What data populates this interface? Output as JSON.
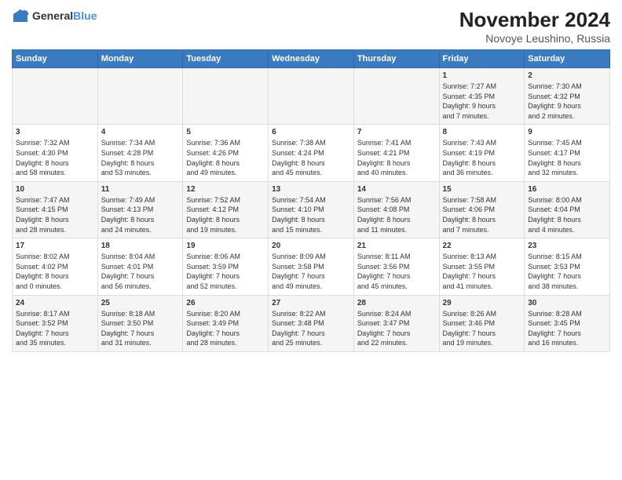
{
  "logo": {
    "general": "General",
    "blue": "Blue"
  },
  "title": "November 2024",
  "subtitle": "Novoye Leushino, Russia",
  "days_of_week": [
    "Sunday",
    "Monday",
    "Tuesday",
    "Wednesday",
    "Thursday",
    "Friday",
    "Saturday"
  ],
  "weeks": [
    [
      {
        "day": "",
        "info": ""
      },
      {
        "day": "",
        "info": ""
      },
      {
        "day": "",
        "info": ""
      },
      {
        "day": "",
        "info": ""
      },
      {
        "day": "",
        "info": ""
      },
      {
        "day": "1",
        "info": "Sunrise: 7:27 AM\nSunset: 4:35 PM\nDaylight: 9 hours\nand 7 minutes."
      },
      {
        "day": "2",
        "info": "Sunrise: 7:30 AM\nSunset: 4:32 PM\nDaylight: 9 hours\nand 2 minutes."
      }
    ],
    [
      {
        "day": "3",
        "info": "Sunrise: 7:32 AM\nSunset: 4:30 PM\nDaylight: 8 hours\nand 58 minutes."
      },
      {
        "day": "4",
        "info": "Sunrise: 7:34 AM\nSunset: 4:28 PM\nDaylight: 8 hours\nand 53 minutes."
      },
      {
        "day": "5",
        "info": "Sunrise: 7:36 AM\nSunset: 4:26 PM\nDaylight: 8 hours\nand 49 minutes."
      },
      {
        "day": "6",
        "info": "Sunrise: 7:38 AM\nSunset: 4:24 PM\nDaylight: 8 hours\nand 45 minutes."
      },
      {
        "day": "7",
        "info": "Sunrise: 7:41 AM\nSunset: 4:21 PM\nDaylight: 8 hours\nand 40 minutes."
      },
      {
        "day": "8",
        "info": "Sunrise: 7:43 AM\nSunset: 4:19 PM\nDaylight: 8 hours\nand 36 minutes."
      },
      {
        "day": "9",
        "info": "Sunrise: 7:45 AM\nSunset: 4:17 PM\nDaylight: 8 hours\nand 32 minutes."
      }
    ],
    [
      {
        "day": "10",
        "info": "Sunrise: 7:47 AM\nSunset: 4:15 PM\nDaylight: 8 hours\nand 28 minutes."
      },
      {
        "day": "11",
        "info": "Sunrise: 7:49 AM\nSunset: 4:13 PM\nDaylight: 8 hours\nand 24 minutes."
      },
      {
        "day": "12",
        "info": "Sunrise: 7:52 AM\nSunset: 4:12 PM\nDaylight: 8 hours\nand 19 minutes."
      },
      {
        "day": "13",
        "info": "Sunrise: 7:54 AM\nSunset: 4:10 PM\nDaylight: 8 hours\nand 15 minutes."
      },
      {
        "day": "14",
        "info": "Sunrise: 7:56 AM\nSunset: 4:08 PM\nDaylight: 8 hours\nand 11 minutes."
      },
      {
        "day": "15",
        "info": "Sunrise: 7:58 AM\nSunset: 4:06 PM\nDaylight: 8 hours\nand 7 minutes."
      },
      {
        "day": "16",
        "info": "Sunrise: 8:00 AM\nSunset: 4:04 PM\nDaylight: 8 hours\nand 4 minutes."
      }
    ],
    [
      {
        "day": "17",
        "info": "Sunrise: 8:02 AM\nSunset: 4:02 PM\nDaylight: 8 hours\nand 0 minutes."
      },
      {
        "day": "18",
        "info": "Sunrise: 8:04 AM\nSunset: 4:01 PM\nDaylight: 7 hours\nand 56 minutes."
      },
      {
        "day": "19",
        "info": "Sunrise: 8:06 AM\nSunset: 3:59 PM\nDaylight: 7 hours\nand 52 minutes."
      },
      {
        "day": "20",
        "info": "Sunrise: 8:09 AM\nSunset: 3:58 PM\nDaylight: 7 hours\nand 49 minutes."
      },
      {
        "day": "21",
        "info": "Sunrise: 8:11 AM\nSunset: 3:56 PM\nDaylight: 7 hours\nand 45 minutes."
      },
      {
        "day": "22",
        "info": "Sunrise: 8:13 AM\nSunset: 3:55 PM\nDaylight: 7 hours\nand 41 minutes."
      },
      {
        "day": "23",
        "info": "Sunrise: 8:15 AM\nSunset: 3:53 PM\nDaylight: 7 hours\nand 38 minutes."
      }
    ],
    [
      {
        "day": "24",
        "info": "Sunrise: 8:17 AM\nSunset: 3:52 PM\nDaylight: 7 hours\nand 35 minutes."
      },
      {
        "day": "25",
        "info": "Sunrise: 8:18 AM\nSunset: 3:50 PM\nDaylight: 7 hours\nand 31 minutes."
      },
      {
        "day": "26",
        "info": "Sunrise: 8:20 AM\nSunset: 3:49 PM\nDaylight: 7 hours\nand 28 minutes."
      },
      {
        "day": "27",
        "info": "Sunrise: 8:22 AM\nSunset: 3:48 PM\nDaylight: 7 hours\nand 25 minutes."
      },
      {
        "day": "28",
        "info": "Sunrise: 8:24 AM\nSunset: 3:47 PM\nDaylight: 7 hours\nand 22 minutes."
      },
      {
        "day": "29",
        "info": "Sunrise: 8:26 AM\nSunset: 3:46 PM\nDaylight: 7 hours\nand 19 minutes."
      },
      {
        "day": "30",
        "info": "Sunrise: 8:28 AM\nSunset: 3:45 PM\nDaylight: 7 hours\nand 16 minutes."
      }
    ]
  ]
}
